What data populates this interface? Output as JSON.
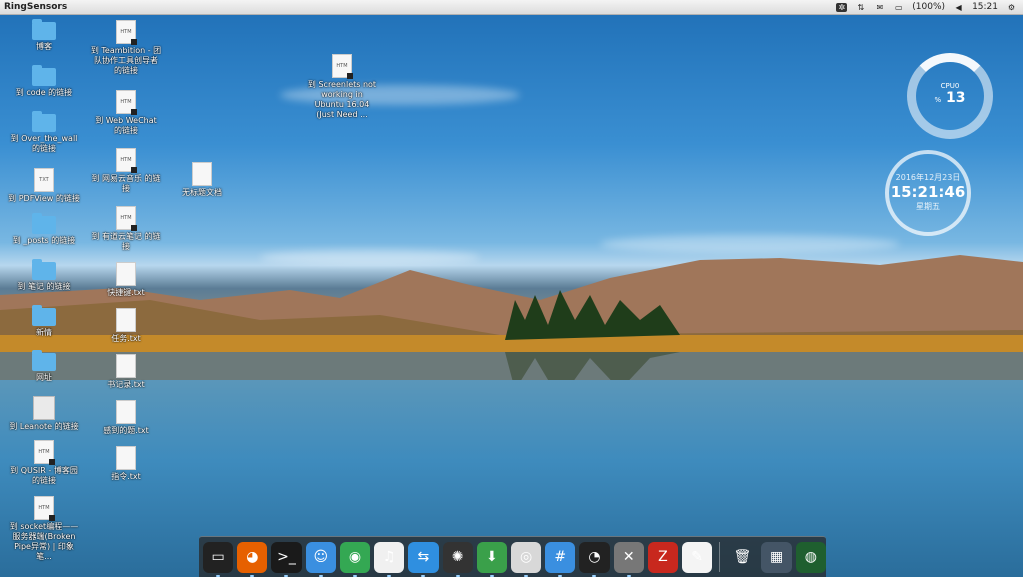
{
  "topbar": {
    "app_name": "RingSensors",
    "battery": "(100%)",
    "time": "15:21"
  },
  "desktop_icons": {
    "col1": [
      {
        "label": "博客"
      },
      {
        "label": "到 code 的链接"
      },
      {
        "label": "到 Over_the_wall 的链接"
      },
      {
        "label": "到 PDFView 的链接",
        "badge": "TXT"
      },
      {
        "label": "到 _posts 的链接"
      },
      {
        "label": "到 笔记 的链接"
      },
      {
        "label": "新情"
      },
      {
        "label": "网址"
      },
      {
        "label": "到 Leanote 的链接"
      },
      {
        "label": "到 QUSIR - 博客园 的链接",
        "badge": "HTM"
      },
      {
        "label": "到 socket编程——服务器端(Broken Pipe异常) | 印象笔...",
        "badge": "HTM"
      }
    ],
    "col2": [
      {
        "label": "到 Teambition - 团队协作工具创导者 的链接",
        "badge": "HTM"
      },
      {
        "label": "到 Web WeChat 的链接",
        "badge": "HTM"
      },
      {
        "label": "到 网易云音乐 的链接",
        "badge": "HTM"
      },
      {
        "label": "到 有道云笔记 的链接",
        "badge": "HTM"
      },
      {
        "label": "快捷键.txt"
      },
      {
        "label": "任务.txt"
      },
      {
        "label": "书记录.txt"
      },
      {
        "label": "感到的题.txt"
      },
      {
        "label": "指令.txt"
      }
    ],
    "col3": [
      {
        "label": "到 Screenlets not working in Ubuntu 16.04 (Just Need ...",
        "badge": "HTM"
      },
      {
        "label": "无标题文档"
      }
    ]
  },
  "cpu_widget": {
    "label": "CPU0",
    "unit": "%",
    "value": "13",
    "percent": 13
  },
  "clock_widget": {
    "date": "2016年12月23日",
    "time": "15:21:46",
    "weekday": "星期五"
  },
  "dock": [
    {
      "name": "workspace-switcher-icon",
      "glyph": "▭",
      "bg": "#222222"
    },
    {
      "name": "firefox-icon",
      "glyph": "◕",
      "bg": "#e66000"
    },
    {
      "name": "terminal-icon",
      "glyph": ">_",
      "bg": "#1a1a1a"
    },
    {
      "name": "finder-icon",
      "glyph": "☺",
      "bg": "#3a8fe0"
    },
    {
      "name": "chrome-icon",
      "glyph": "◉",
      "bg": "#34a853"
    },
    {
      "name": "music-icon",
      "glyph": "♫",
      "bg": "#f0f0f0"
    },
    {
      "name": "share-icon",
      "glyph": "⇆",
      "bg": "#2f8fe0"
    },
    {
      "name": "aperture-icon",
      "glyph": "✺",
      "bg": "#333333"
    },
    {
      "name": "download-icon",
      "glyph": "⬇",
      "bg": "#3aa04a"
    },
    {
      "name": "disk-icon",
      "glyph": "◎",
      "bg": "#d8d8d8"
    },
    {
      "name": "hashtag-icon",
      "glyph": "#",
      "bg": "#3a8fe0"
    },
    {
      "name": "dashboard-icon",
      "glyph": "◔",
      "bg": "#222222"
    },
    {
      "name": "settings-icon",
      "glyph": "✕",
      "bg": "#777777"
    },
    {
      "name": "filezilla-icon",
      "glyph": "Z",
      "bg": "#c8281e"
    },
    {
      "name": "text-editor-icon",
      "glyph": "✎",
      "bg": "#f4f4f4"
    },
    {
      "name": "trash-icon",
      "glyph": "🗑",
      "bg": "transparent"
    },
    {
      "name": "show-desktop-icon",
      "glyph": "▦",
      "bg": "#445566"
    },
    {
      "name": "radar-icon",
      "glyph": "◍",
      "bg": "#1f5f2f"
    }
  ]
}
